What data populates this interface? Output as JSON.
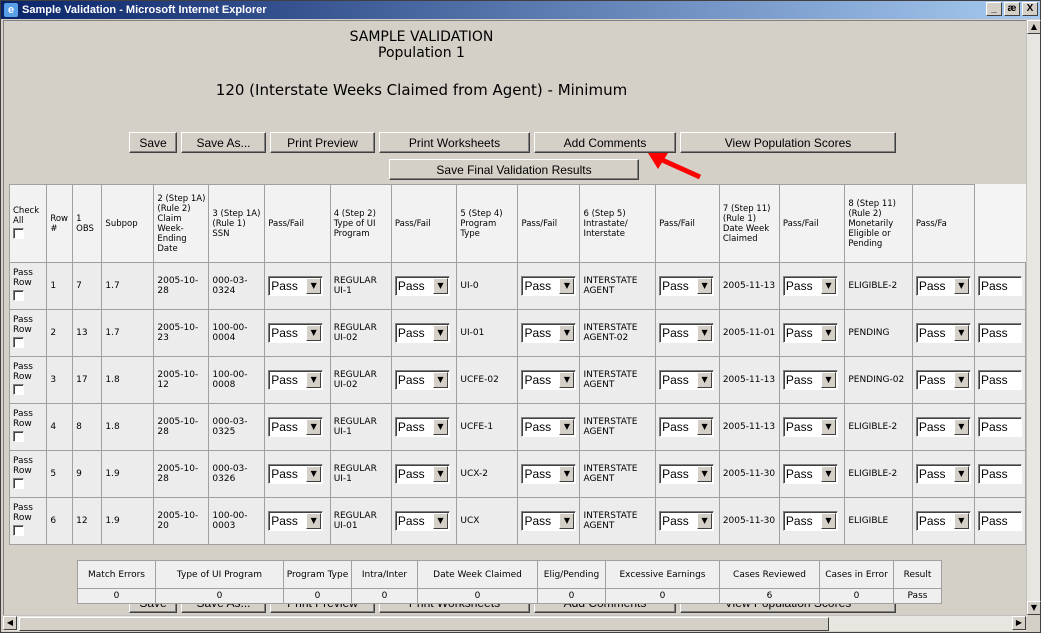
{
  "window": {
    "title": "Sample Validation - Microsoft Internet Explorer",
    "controls": [
      "_",
      "æ",
      "X"
    ]
  },
  "header": {
    "line1": "SAMPLE VALIDATION",
    "line2": "Population 1",
    "subtitle": "120 (Interstate Weeks Claimed from Agent) - Minimum"
  },
  "toolbar": {
    "save": "Save",
    "save_as": "Save As...",
    "print_preview": "Print Preview",
    "print_worksheets": "Print Worksheets",
    "add_comments": "Add Comments",
    "view_scores": "View Population Scores"
  },
  "save_final": "Save Final Validation Results",
  "table": {
    "headers": {
      "check_all": "Check All",
      "row": "Row #",
      "obs": "1 OBS",
      "subpop": "Subpop",
      "c2": "2 (Step 1A) (Rule 2) Claim Week- Ending Date",
      "c3": "3 (Step 1A) (Rule 1) SSN",
      "pf": "Pass/Fail",
      "c4": "4 (Step 2) Type of UI Program",
      "c5": "5 (Step 4) Program Type",
      "c6": "6 (Step 5) Intrastate/ Interstate",
      "c7": "7 (Step 11) (Rule 1) Date Week Claimed",
      "c8": "8 (Step 11) (Rule 2) Monetarily Eligible or Pending",
      "pf_last": "Pass/Fa"
    },
    "pass_row": "Pass Row",
    "rows": [
      {
        "row": "1",
        "obs": "7",
        "subpop": "1.7",
        "date": "2005-10-28",
        "ssn": "000-03-0324",
        "ui": "REGULAR UI-1",
        "ptype": "UI-0",
        "inter": "INTERSTATE AGENT",
        "claimed": "2005-11-13",
        "elig": "ELIGIBLE-2",
        "pf1": "Pass",
        "pf2": "Pass",
        "pf3": "Pass",
        "pf4": "Pass",
        "pf5": "Pass",
        "pf6": "Pass",
        "pf7": "Pass"
      },
      {
        "row": "2",
        "obs": "13",
        "subpop": "1.7",
        "date": "2005-10-23",
        "ssn": "100-00-0004",
        "ui": "REGULAR UI-02",
        "ptype": "UI-01",
        "inter": "INTERSTATE AGENT-02",
        "claimed": "2005-11-01",
        "elig": "PENDING",
        "pf1": "Pass",
        "pf2": "Pass",
        "pf3": "Pass",
        "pf4": "Pass",
        "pf5": "Pass",
        "pf6": "Pass",
        "pf7": "Pass"
      },
      {
        "row": "3",
        "obs": "17",
        "subpop": "1.8",
        "date": "2005-10-12",
        "ssn": "100-00-0008",
        "ui": "REGULAR UI-02",
        "ptype": "UCFE-02",
        "inter": "INTERSTATE AGENT",
        "claimed": "2005-11-13",
        "elig": "PENDING-02",
        "pf1": "Pass",
        "pf2": "Pass",
        "pf3": "Pass",
        "pf4": "Pass",
        "pf5": "Pass",
        "pf6": "Pass",
        "pf7": "Pass"
      },
      {
        "row": "4",
        "obs": "8",
        "subpop": "1.8",
        "date": "2005-10-28",
        "ssn": "000-03-0325",
        "ui": "REGULAR UI-1",
        "ptype": "UCFE-1",
        "inter": "INTERSTATE AGENT",
        "claimed": "2005-11-13",
        "elig": "ELIGIBLE-2",
        "pf1": "Pass",
        "pf2": "Pass",
        "pf3": "Pass",
        "pf4": "Pass",
        "pf5": "Pass",
        "pf6": "Pass",
        "pf7": "Pass"
      },
      {
        "row": "5",
        "obs": "9",
        "subpop": "1.9",
        "date": "2005-10-28",
        "ssn": "000-03-0326",
        "ui": "REGULAR UI-1",
        "ptype": "UCX-2",
        "inter": "INTERSTATE AGENT",
        "claimed": "2005-11-30",
        "elig": "ELIGIBLE-2",
        "pf1": "Pass",
        "pf2": "Pass",
        "pf3": "Pass",
        "pf4": "Pass",
        "pf5": "Pass",
        "pf6": "Pass",
        "pf7": "Pass"
      },
      {
        "row": "6",
        "obs": "12",
        "subpop": "1.9",
        "date": "2005-10-20",
        "ssn": "100-00-0003",
        "ui": "REGULAR UI-01",
        "ptype": "UCX",
        "inter": "INTERSTATE AGENT",
        "claimed": "2005-11-30",
        "elig": "ELIGIBLE",
        "pf1": "Pass",
        "pf2": "Pass",
        "pf3": "Pass",
        "pf4": "Pass",
        "pf5": "Pass",
        "pf6": "Pass",
        "pf7": "Pass"
      }
    ]
  },
  "summary": {
    "headers": [
      "Match Errors",
      "Type of UI Program",
      "Program Type",
      "Intra/Inter",
      "Date Week Claimed",
      "Elig/Pending",
      "Excessive Earnings",
      "Cases Reviewed",
      "Cases in Error",
      "Result"
    ],
    "values": [
      "0",
      "0",
      "0",
      "0",
      "0",
      "0",
      "0",
      "6",
      "0",
      "Pass"
    ]
  }
}
